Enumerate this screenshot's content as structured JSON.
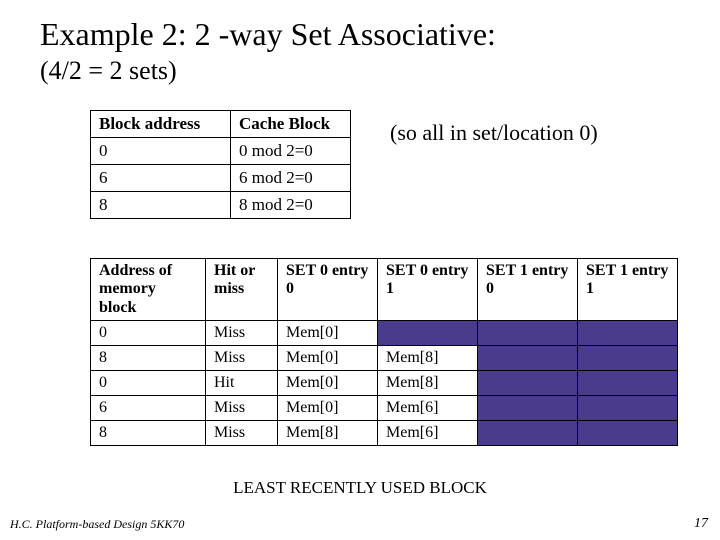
{
  "title": "Example 2:    2 -way Set Associative:",
  "subtitle": "(4/2 = 2 sets)",
  "side_note": "(so all in set/location 0)",
  "map_table": {
    "headers": [
      "Block address",
      "Cache Block"
    ],
    "rows": [
      [
        "0",
        "0 mod 2=0"
      ],
      [
        "6",
        "6 mod 2=0"
      ],
      [
        "8",
        "8 mod 2=0"
      ]
    ]
  },
  "trace_table": {
    "headers": [
      "Address of memory block",
      "Hit or miss",
      "SET 0 entry 0",
      "SET 0 entry 1",
      "SET 1 entry 0",
      "SET 1 entry 1"
    ],
    "rows": [
      {
        "cells": [
          "0",
          "Miss",
          "Mem[0]",
          "",
          "",
          ""
        ],
        "purple": [
          false,
          false,
          false,
          true,
          true,
          true
        ]
      },
      {
        "cells": [
          "8",
          "Miss",
          "Mem[0]",
          "Mem[8]",
          "",
          ""
        ],
        "purple": [
          false,
          false,
          false,
          false,
          true,
          true
        ]
      },
      {
        "cells": [
          "0",
          "Hit",
          "Mem[0]",
          "Mem[8]",
          "",
          ""
        ],
        "purple": [
          false,
          false,
          false,
          false,
          true,
          true
        ]
      },
      {
        "cells": [
          "6",
          "Miss",
          "Mem[0]",
          "Mem[6]",
          "",
          ""
        ],
        "purple": [
          false,
          false,
          false,
          false,
          true,
          true
        ]
      },
      {
        "cells": [
          "8",
          "Miss",
          "Mem[8]",
          "Mem[6]",
          "",
          ""
        ],
        "purple": [
          false,
          false,
          false,
          false,
          true,
          true
        ]
      }
    ]
  },
  "lru_caption": "LEAST RECENTLY USED BLOCK",
  "footer_left": "H.C.   Platform-based Design 5KK70",
  "footer_right": "17"
}
